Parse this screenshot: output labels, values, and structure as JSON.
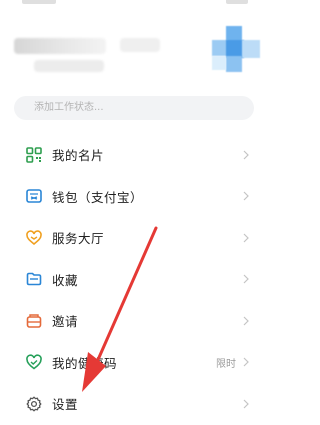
{
  "profile": {
    "status_placeholder": "添加工作状态..."
  },
  "menu": {
    "items": [
      {
        "label": "我的名片",
        "icon": "qr-card-icon",
        "color": "#2e9e4f"
      },
      {
        "label": "钱包（支付宝）",
        "icon": "wallet-icon",
        "color": "#2a86d6"
      },
      {
        "label": "服务大厅",
        "icon": "heart-service-icon",
        "color": "#f0a020"
      },
      {
        "label": "收藏",
        "icon": "folder-collect-icon",
        "color": "#2a86d6"
      },
      {
        "label": "邀请",
        "icon": "invite-icon",
        "color": "#e46a3a"
      },
      {
        "label": "我的健康码",
        "extra": "限时",
        "icon": "health-code-icon",
        "color": "#26a05a"
      },
      {
        "label": "设置",
        "icon": "gear-icon",
        "color": "#555555"
      }
    ]
  },
  "annotation": {
    "arrow_color": "#e53935"
  }
}
